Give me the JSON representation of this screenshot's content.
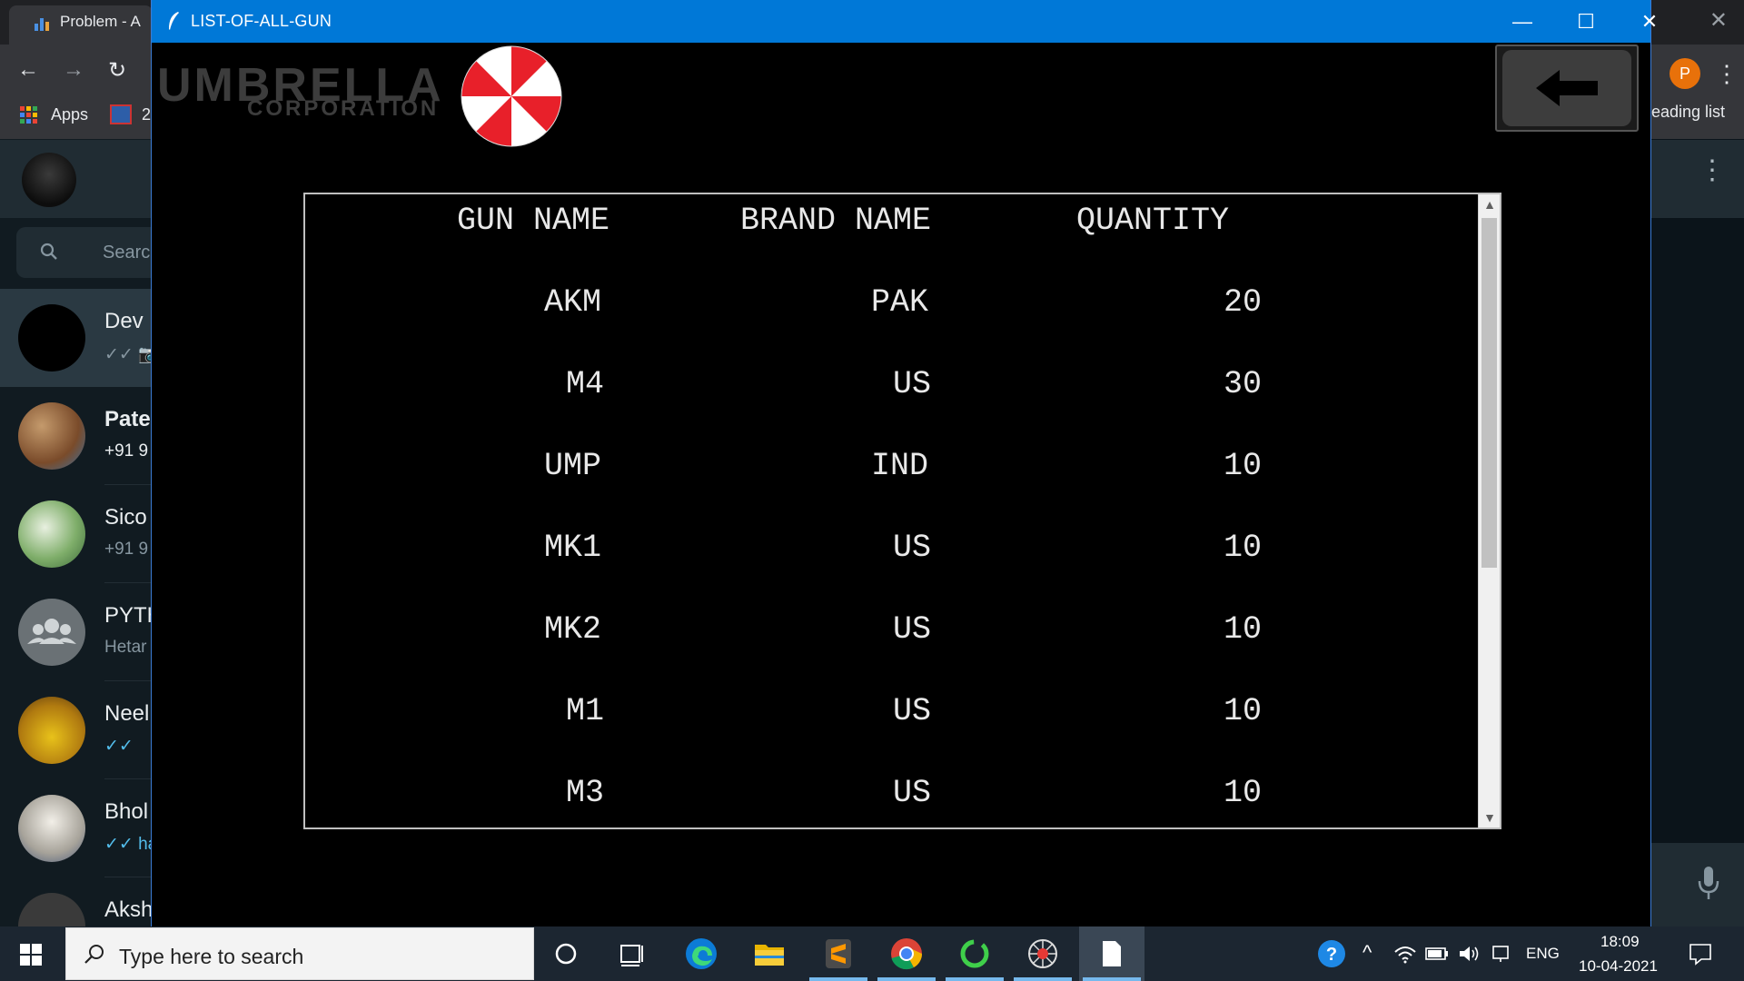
{
  "browser": {
    "tab_title": "Problem - A",
    "bookmarks_apps": "Apps",
    "bookmark_2": "2",
    "profile_initial": "P",
    "reading_list": "eading list"
  },
  "whatsapp": {
    "search_placeholder": "Searc",
    "chats": [
      {
        "name": "Dev",
        "sub": "✓✓ 📷"
      },
      {
        "name": "Pate",
        "sub": "+91 9"
      },
      {
        "name": "Sico",
        "sub": "+91 9"
      },
      {
        "name": "PYTH",
        "sub": "Hetar"
      },
      {
        "name": "Neel",
        "sub": "✓✓"
      },
      {
        "name": "Bhol",
        "sub": "✓✓ ha"
      },
      {
        "name": "Aksh",
        "sub": ""
      }
    ]
  },
  "window": {
    "title": "LIST-OF-ALL-GUN",
    "logo_line1": "UMBRELLA",
    "logo_line2": "CORPORATION"
  },
  "table": {
    "headers": [
      "GUN NAME",
      "BRAND NAME",
      "QUANTITY"
    ],
    "rows": [
      {
        "gun": "AKM",
        "brand": "PAK",
        "qty": "20"
      },
      {
        "gun": "M4",
        "brand": "US",
        "qty": "30"
      },
      {
        "gun": "UMP",
        "brand": "IND",
        "qty": "10"
      },
      {
        "gun": "MK1",
        "brand": "US",
        "qty": "10"
      },
      {
        "gun": "MK2",
        "brand": "US",
        "qty": "10"
      },
      {
        "gun": "M1",
        "brand": "US",
        "qty": "10"
      },
      {
        "gun": "M3",
        "brand": "US",
        "qty": "10"
      }
    ]
  },
  "taskbar": {
    "search_placeholder": "Type here to search",
    "language": "ENG",
    "time": "18:09",
    "date": "10-04-2021"
  },
  "colors": {
    "titlebar": "#0078d7",
    "window_bg": "#000000",
    "umbrella_red": "#e8202a",
    "table_text": "#e8e8e8"
  }
}
